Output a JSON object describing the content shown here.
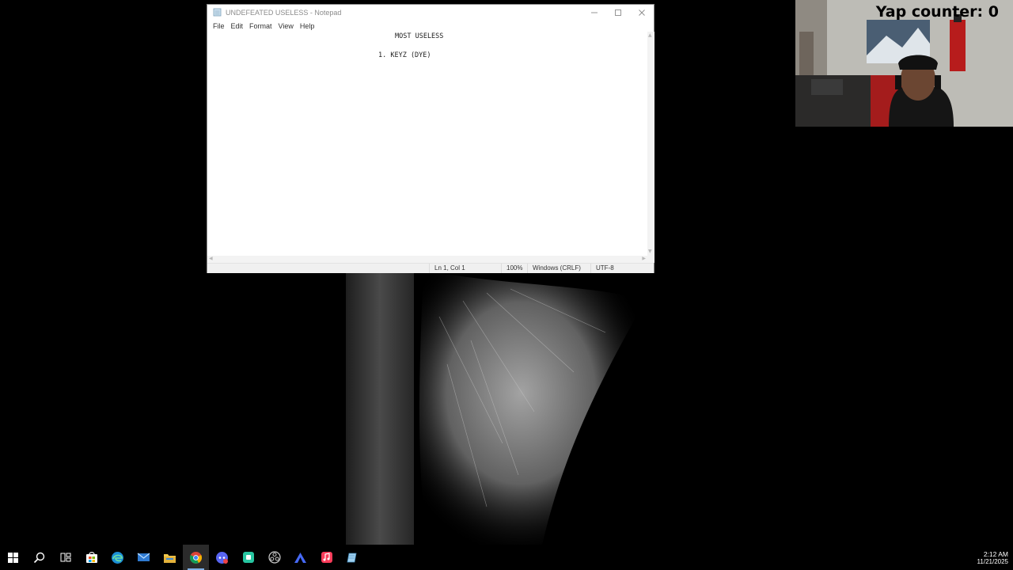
{
  "notepad": {
    "title": "UNDEFEATED USELESS - Notepad",
    "menu": [
      "File",
      "Edit",
      "Format",
      "View",
      "Help"
    ],
    "content": {
      "heading": "MOST USELESS",
      "line1": "1. KEYZ (DYE)"
    },
    "status": {
      "position": "Ln 1, Col 1",
      "zoom": "100%",
      "line_ending": "Windows (CRLF)",
      "encoding": "UTF-8"
    }
  },
  "overlay": {
    "yap_counter": "Yap counter: 0"
  },
  "taskbar": {
    "icons": [
      "windows-start-icon",
      "search-icon",
      "task-view-icon",
      "store-icon",
      "edge-icon",
      "mail-icon",
      "file-explorer-icon",
      "chrome-icon",
      "discord-icon",
      "android-app-icon",
      "obs-icon",
      "vpn-icon",
      "music-icon",
      "notepad-icon"
    ],
    "time": "2:12 AM",
    "date": "11/21/2025"
  },
  "colors": {
    "taskbar_bg": "#000000",
    "window_bg": "#ffffff",
    "accent": "#7fb0e6"
  }
}
